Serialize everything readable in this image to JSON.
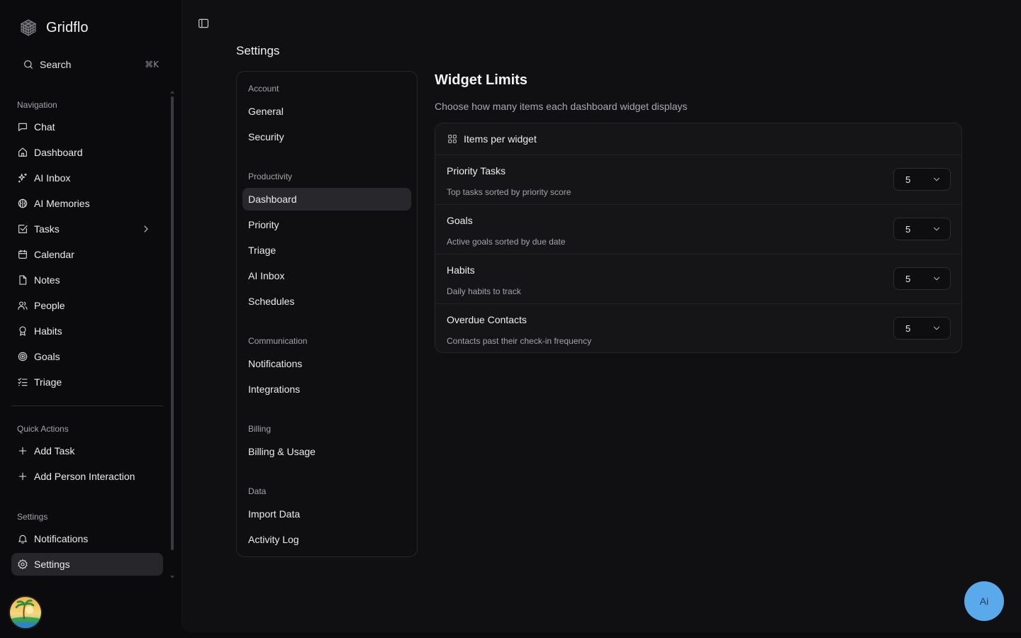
{
  "app": {
    "name": "Gridflo"
  },
  "search": {
    "label": "Search",
    "shortcut": "⌘K"
  },
  "sidebar": {
    "navigation_label": "Navigation",
    "nav_items": [
      {
        "label": "Chat",
        "icon": "message-square-icon"
      },
      {
        "label": "Dashboard",
        "icon": "home-icon"
      },
      {
        "label": "AI Inbox",
        "icon": "sparkles-icon"
      },
      {
        "label": "AI Memories",
        "icon": "brain-icon"
      },
      {
        "label": "Tasks",
        "icon": "check-square-icon",
        "has_submenu": true
      },
      {
        "label": "Calendar",
        "icon": "calendar-icon"
      },
      {
        "label": "Notes",
        "icon": "file-icon"
      },
      {
        "label": "People",
        "icon": "users-icon"
      },
      {
        "label": "Habits",
        "icon": "award-icon"
      },
      {
        "label": "Goals",
        "icon": "target-icon"
      },
      {
        "label": "Triage",
        "icon": "list-checks-icon"
      }
    ],
    "quick_actions_label": "Quick Actions",
    "quick_actions": [
      {
        "label": "Add Task",
        "icon": "plus-icon"
      },
      {
        "label": "Add Person Interaction",
        "icon": "plus-icon"
      }
    ],
    "settings_label": "Settings",
    "settings_items": [
      {
        "label": "Notifications",
        "icon": "bell-icon"
      },
      {
        "label": "Settings",
        "icon": "gear-icon",
        "active": true
      }
    ]
  },
  "main": {
    "page_title": "Settings"
  },
  "settings_nav": {
    "groups": [
      {
        "label": "Account",
        "items": [
          "General",
          "Security"
        ]
      },
      {
        "label": "Productivity",
        "items": [
          "Dashboard",
          "Priority",
          "Triage",
          "AI Inbox",
          "Schedules"
        ],
        "active": "Dashboard"
      },
      {
        "label": "Communication",
        "items": [
          "Notifications",
          "Integrations"
        ]
      },
      {
        "label": "Billing",
        "items": [
          "Billing & Usage"
        ]
      },
      {
        "label": "Data",
        "items": [
          "Import Data",
          "Activity Log"
        ]
      }
    ]
  },
  "content": {
    "title": "Widget Limits",
    "subtitle": "Choose how many items each dashboard widget displays",
    "card_title": "Items per widget",
    "rows": [
      {
        "title": "Priority Tasks",
        "desc": "Top tasks sorted by priority score",
        "value": "5"
      },
      {
        "title": "Goals",
        "desc": "Active goals sorted by due date",
        "value": "5"
      },
      {
        "title": "Habits",
        "desc": "Daily habits to track",
        "value": "5"
      },
      {
        "title": "Overdue Contacts",
        "desc": "Contacts past their check-in frequency",
        "value": "5"
      }
    ]
  },
  "fab": {
    "label": "Ai"
  },
  "colors": {
    "background": "#0b0b0d",
    "panel": "#101012",
    "card": "#151518",
    "active": "#27272c",
    "fab": "#5aa9ea"
  }
}
